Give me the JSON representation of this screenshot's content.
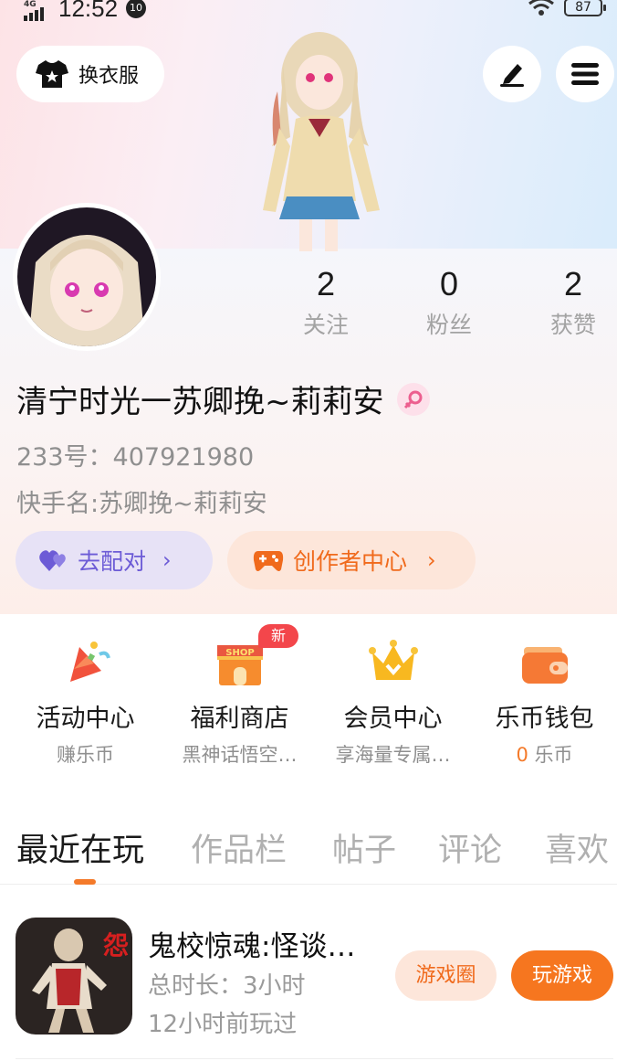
{
  "status_bar": {
    "network": "4G",
    "time": "12:52",
    "notification": "10",
    "battery": "87"
  },
  "header": {
    "outfit_label": "换衣服",
    "icons": {
      "outfit": "tshirt-icon",
      "edit": "pencil-icon",
      "menu": "menu-icon"
    }
  },
  "profile": {
    "stats": [
      {
        "value": "2",
        "label": "关注"
      },
      {
        "value": "0",
        "label": "粉丝"
      },
      {
        "value": "2",
        "label": "获赞"
      }
    ],
    "name": "清宁时光一苏卿挽~莉莉安",
    "gender_icon": "female-icon",
    "id_line": "233号：407921980",
    "kuaishou_line": "快手名:苏卿挽~莉莉安",
    "match_label": "去配对",
    "creator_label": "创作者中心"
  },
  "quick_entries": [
    {
      "title": "活动中心",
      "sub": "赚乐币",
      "icon": "party-popper-icon"
    },
    {
      "title": "福利商店",
      "sub": "黑神话悟空…",
      "icon": "shop-icon",
      "badge": "新"
    },
    {
      "title": "会员中心",
      "sub": "享海量专属…",
      "icon": "crown-icon"
    },
    {
      "title": "乐币钱包",
      "sub_num": "0",
      "sub": "乐币",
      "icon": "wallet-icon"
    }
  ],
  "tabs": [
    "最近在玩",
    "作品栏",
    "帖子",
    "评论",
    "喜欢"
  ],
  "recent_game": {
    "name": "鬼校惊魂:怪谈…",
    "total_time": "总时长：3小时",
    "last_played": "12小时前玩过",
    "circle_label": "游戏圈",
    "play_label": "玩游戏"
  },
  "colors": {
    "accent": "#f6761f",
    "match": "#6c5bd6",
    "badge": "#f3464b"
  }
}
